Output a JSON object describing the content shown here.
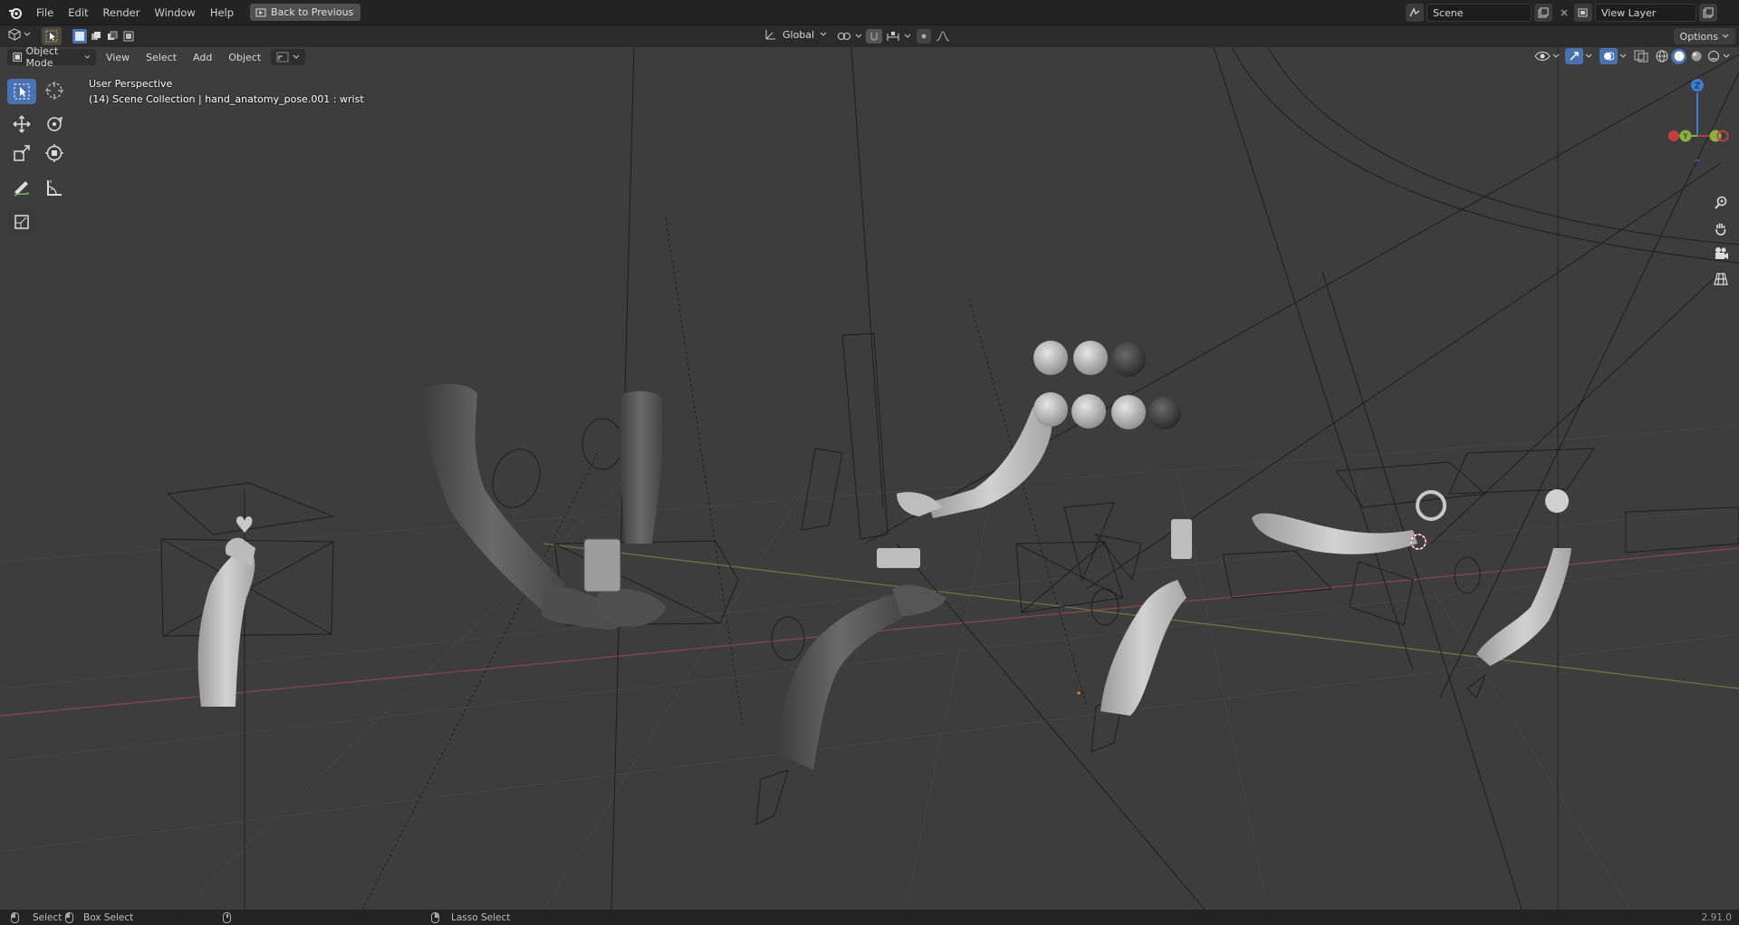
{
  "menu": {
    "items": [
      "File",
      "Edit",
      "Render",
      "Window",
      "Help"
    ],
    "back_button": "Back to Previous"
  },
  "scene": {
    "scene_name": "Scene",
    "view_layer": "View Layer"
  },
  "tool_header": {
    "transform_orientation": "Global",
    "options_label": "Options"
  },
  "viewport_header": {
    "mode": "Object Mode",
    "menus": [
      "View",
      "Select",
      "Add",
      "Object"
    ]
  },
  "viewport": {
    "perspective": "User Perspective",
    "collection_info": "(14) Scene Collection | hand_anatomy_pose.001 : wrist",
    "gizmo_axes": {
      "z": "Z",
      "y": "Y"
    }
  },
  "status": {
    "select": "Select",
    "box_select": "Box Select",
    "lasso_select": "Lasso Select",
    "version": "2.91.0"
  },
  "colors": {
    "viewport_bg": "#3d3d3d",
    "active_tool": "#4a72b0",
    "x_axis": "#b04040",
    "y_axis": "#8ab040",
    "z_axis": "#3c7bd6"
  }
}
